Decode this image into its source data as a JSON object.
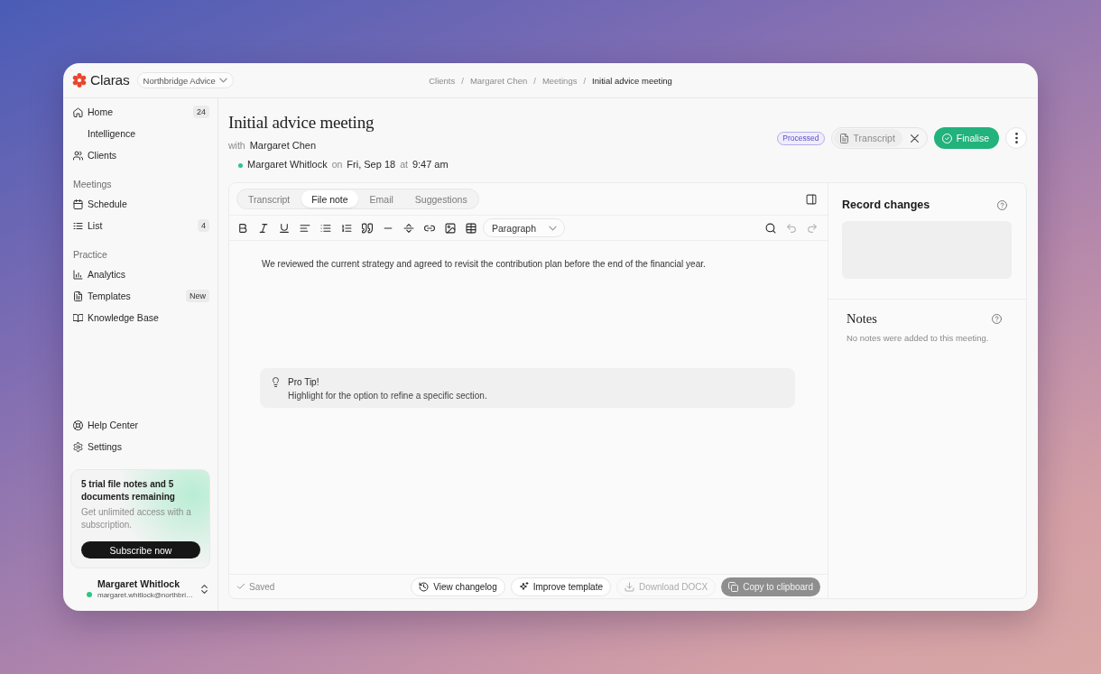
{
  "topbar": {
    "brand": "Claras",
    "workspace": "Northbridge Advice",
    "breadcrumbs": {
      "separator": "/",
      "items": [
        {
          "label": "Clients",
          "current": false
        },
        {
          "label": "Margaret Chen",
          "current": false
        },
        {
          "label": "Meetings",
          "current": false
        },
        {
          "label": "Initial advice meeting",
          "current": true
        }
      ]
    }
  },
  "sidebar": {
    "sections": [
      {
        "items": [
          {
            "label": "Home",
            "badge": "24",
            "selected": false
          },
          {
            "label": "Intelligence",
            "selected": false
          },
          {
            "label": "Clients",
            "selected": false
          }
        ]
      },
      {
        "title": "Meetings",
        "items": [
          {
            "label": "Schedule",
            "selected": false
          },
          {
            "label": "List",
            "badge": "4",
            "selected": false
          }
        ]
      },
      {
        "title": "Practice",
        "items": [
          {
            "label": "Analytics",
            "selected": false
          },
          {
            "label": "Templates",
            "badge": "New",
            "selected": false
          },
          {
            "label": "Knowledge Base",
            "selected": false
          }
        ]
      }
    ],
    "footer_items": [
      {
        "label": "Help Center",
        "selected": false
      },
      {
        "label": "Settings",
        "selected": false
      }
    ],
    "trial_card": {
      "title": "5 trial file notes and 5 documents remaining",
      "text": "Get unlimited access with a subscription.",
      "button": "Subscribe now"
    },
    "user": {
      "name": "Margaret Whitlock",
      "email": "margaret.whitlock@northbri…",
      "online": true
    }
  },
  "meeting": {
    "title": "Initial advice meeting",
    "with_label": "with",
    "client": "Margaret Chen",
    "attendee": {
      "online": true,
      "name": "Margaret Whitlock",
      "on_label": "on",
      "date": "Fri, Sep 18",
      "at_label": "at",
      "time": "9:47 am"
    },
    "status": "Processed",
    "attachment": "Transcript",
    "finalise_button": "Finalise"
  },
  "editor": {
    "tabs": [
      {
        "label": "Transcript",
        "selected": false
      },
      {
        "label": "File note",
        "selected": true
      },
      {
        "label": "Email",
        "selected": false
      },
      {
        "label": "Suggestions",
        "selected": false
      }
    ],
    "block_style": "Paragraph",
    "undo": {
      "disabled": true
    },
    "redo": {
      "disabled": true
    },
    "content": "We reviewed the current strategy and agreed to revisit the contribution plan before the end of the financial year.",
    "tip": {
      "title": "Pro Tip!",
      "text": "Highlight for the option to refine a specific section."
    },
    "save_status": "Saved",
    "actions": [
      {
        "kind": "outline",
        "label": "View changelog",
        "disabled": false
      },
      {
        "kind": "outline",
        "label": "Improve template",
        "disabled": false
      },
      {
        "kind": "outline",
        "label": "Download DOCX",
        "disabled": true
      },
      {
        "kind": "filled",
        "label": "Copy to clipboard",
        "disabled": true
      }
    ]
  },
  "side_panel": {
    "record_changes": {
      "title": "Record changes"
    },
    "notes": {
      "title": "Notes",
      "empty_text": "No notes were added to this meeting."
    }
  }
}
